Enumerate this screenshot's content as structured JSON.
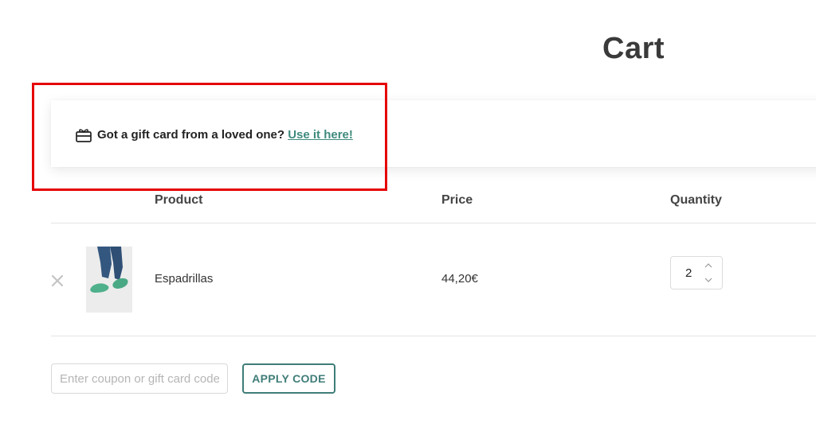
{
  "page": {
    "title": "Cart"
  },
  "gift_notice": {
    "icon": "gift-card-icon",
    "text": "Got a gift card from a loved one?",
    "link_label": "Use it here!"
  },
  "table": {
    "headers": {
      "product": "Product",
      "price": "Price",
      "quantity": "Quantity"
    },
    "rows": [
      {
        "remove_icon": "close-icon",
        "product": "Espadrillas",
        "price": "44,20€",
        "quantity": "2"
      }
    ]
  },
  "coupon": {
    "placeholder": "Enter coupon or gift card code",
    "value": "",
    "apply_label": "APPLY CODE"
  },
  "colors": {
    "accent": "#3f7d78",
    "link": "#3f8a7e",
    "highlight": "#e60000"
  }
}
